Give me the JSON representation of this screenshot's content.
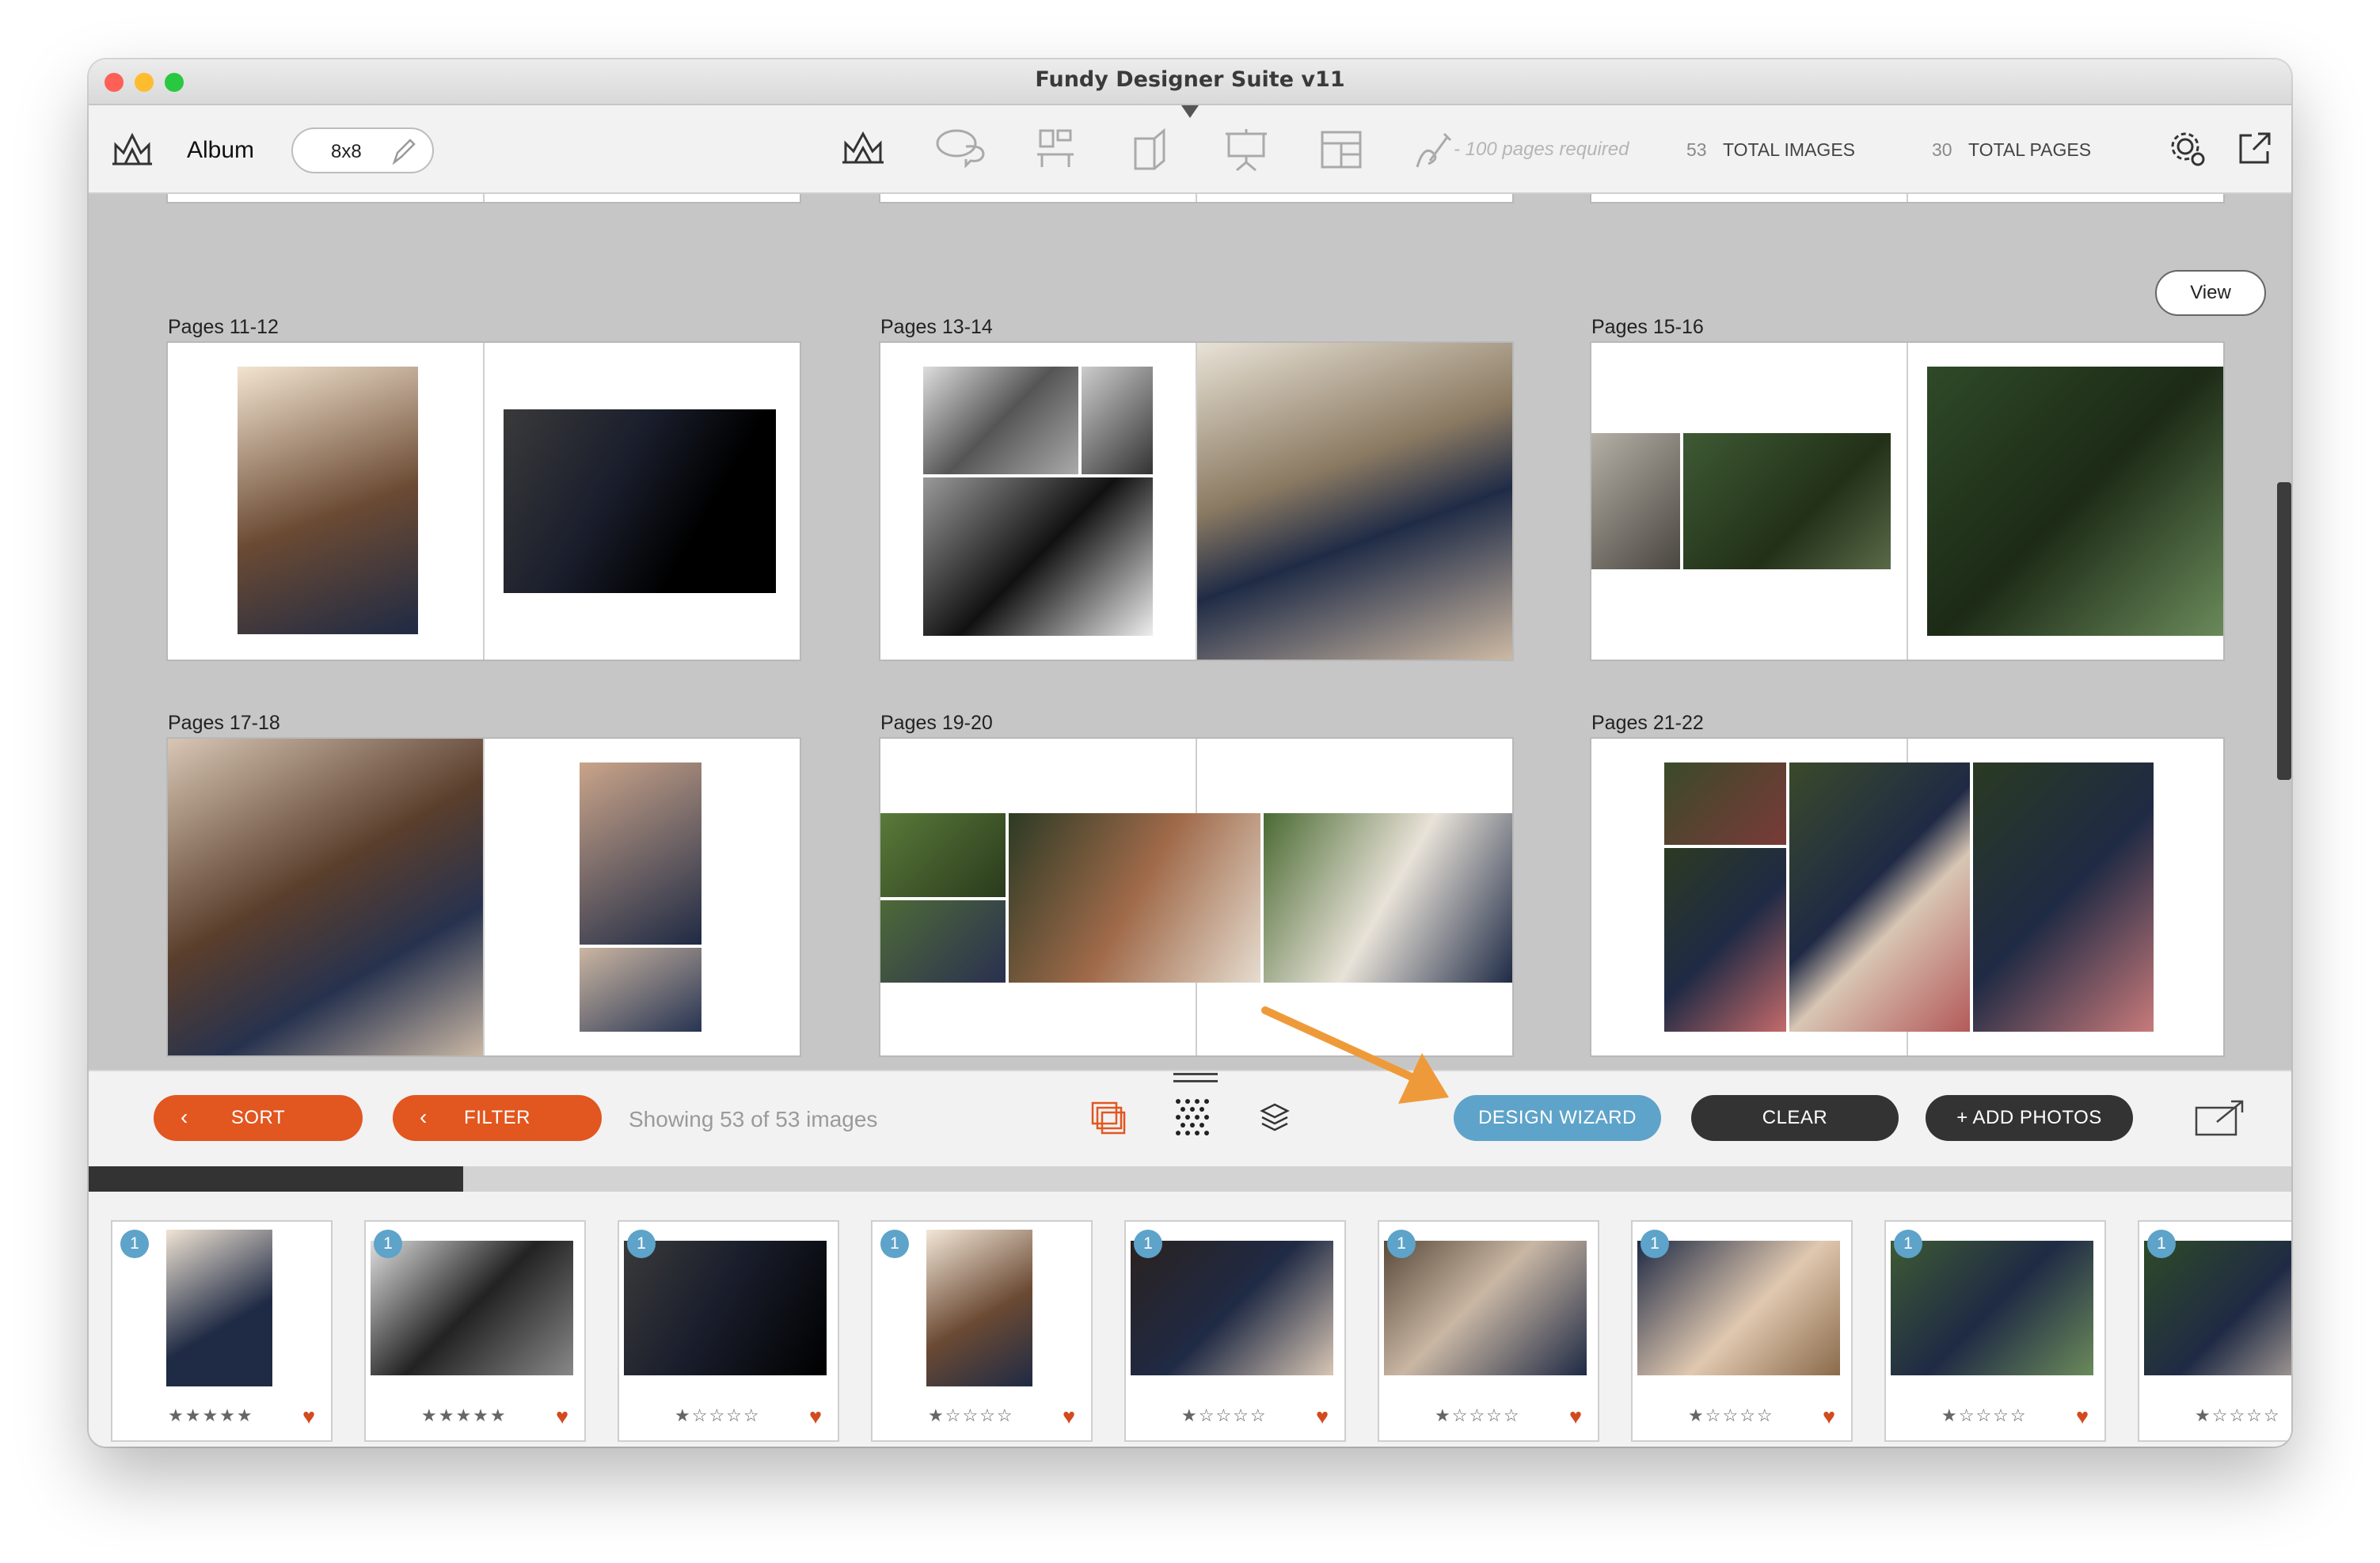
{
  "window": {
    "title": "Fundy Designer Suite v11"
  },
  "toolbar": {
    "product_label": "Album",
    "size_value": "8x8",
    "pages_required": "- 100 pages required",
    "total_images_count": "53",
    "total_images_label": "TOTAL IMAGES",
    "total_pages_count": "30",
    "total_pages_label": "TOTAL PAGES"
  },
  "main": {
    "view_button": "View",
    "spreads": [
      {
        "label": "Pages 11-12"
      },
      {
        "label": "Pages 13-14"
      },
      {
        "label": "Pages 15-16"
      },
      {
        "label": "Pages 17-18"
      },
      {
        "label": "Pages 19-20"
      },
      {
        "label": "Pages 21-22"
      }
    ]
  },
  "bottombar": {
    "sort": "SORT",
    "filter": "FILTER",
    "showing": "Showing 53 of 53 images",
    "design_wizard": "DESIGN WIZARD",
    "clear": "CLEAR",
    "add_photos": "+ ADD PHOTOS"
  },
  "progress": {
    "fraction": 0.17
  },
  "thumbnails": [
    {
      "badge": "1",
      "stars": "★★★★★",
      "heart": "♥"
    },
    {
      "badge": "1",
      "stars": "★★★★★",
      "heart": "♥"
    },
    {
      "badge": "1",
      "stars": "★☆☆☆☆",
      "heart": "♥"
    },
    {
      "badge": "1",
      "stars": "★☆☆☆☆",
      "heart": "♥"
    },
    {
      "badge": "1",
      "stars": "★☆☆☆☆",
      "heart": "♥"
    },
    {
      "badge": "1",
      "stars": "★☆☆☆☆",
      "heart": "♥"
    },
    {
      "badge": "1",
      "stars": "★☆☆☆☆",
      "heart": "♥"
    },
    {
      "badge": "1",
      "stars": "★☆☆☆☆",
      "heart": "♥"
    },
    {
      "badge": "1",
      "stars": "★☆☆☆☆",
      "heart": "♥"
    }
  ],
  "colors": {
    "orange": "#e2561f",
    "blue": "#5ea3c9",
    "dark": "#333333",
    "arrow": "#ef9a3a"
  }
}
